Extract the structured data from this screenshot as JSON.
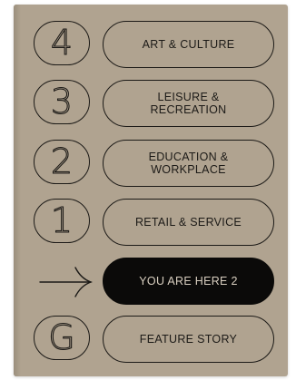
{
  "cover": {
    "background_color": "#b0a390",
    "ink_color": "#1c1a17",
    "active_fill": "#0b0a09"
  },
  "levels": [
    {
      "marker": "4",
      "label": "ART & CULTURE",
      "active": false
    },
    {
      "marker": "3",
      "label": "LEISURE &\nRECREATION",
      "active": false
    },
    {
      "marker": "2",
      "label": "EDUCATION &\nWORKPLACE",
      "active": false
    },
    {
      "marker": "1",
      "label": "RETAIL & SERVICE",
      "active": false
    },
    {
      "marker_icon": "arrow-right-icon",
      "label": "YOU ARE HERE 2",
      "active": true
    },
    {
      "marker": "G",
      "label": "FEATURE STORY",
      "active": false
    }
  ]
}
